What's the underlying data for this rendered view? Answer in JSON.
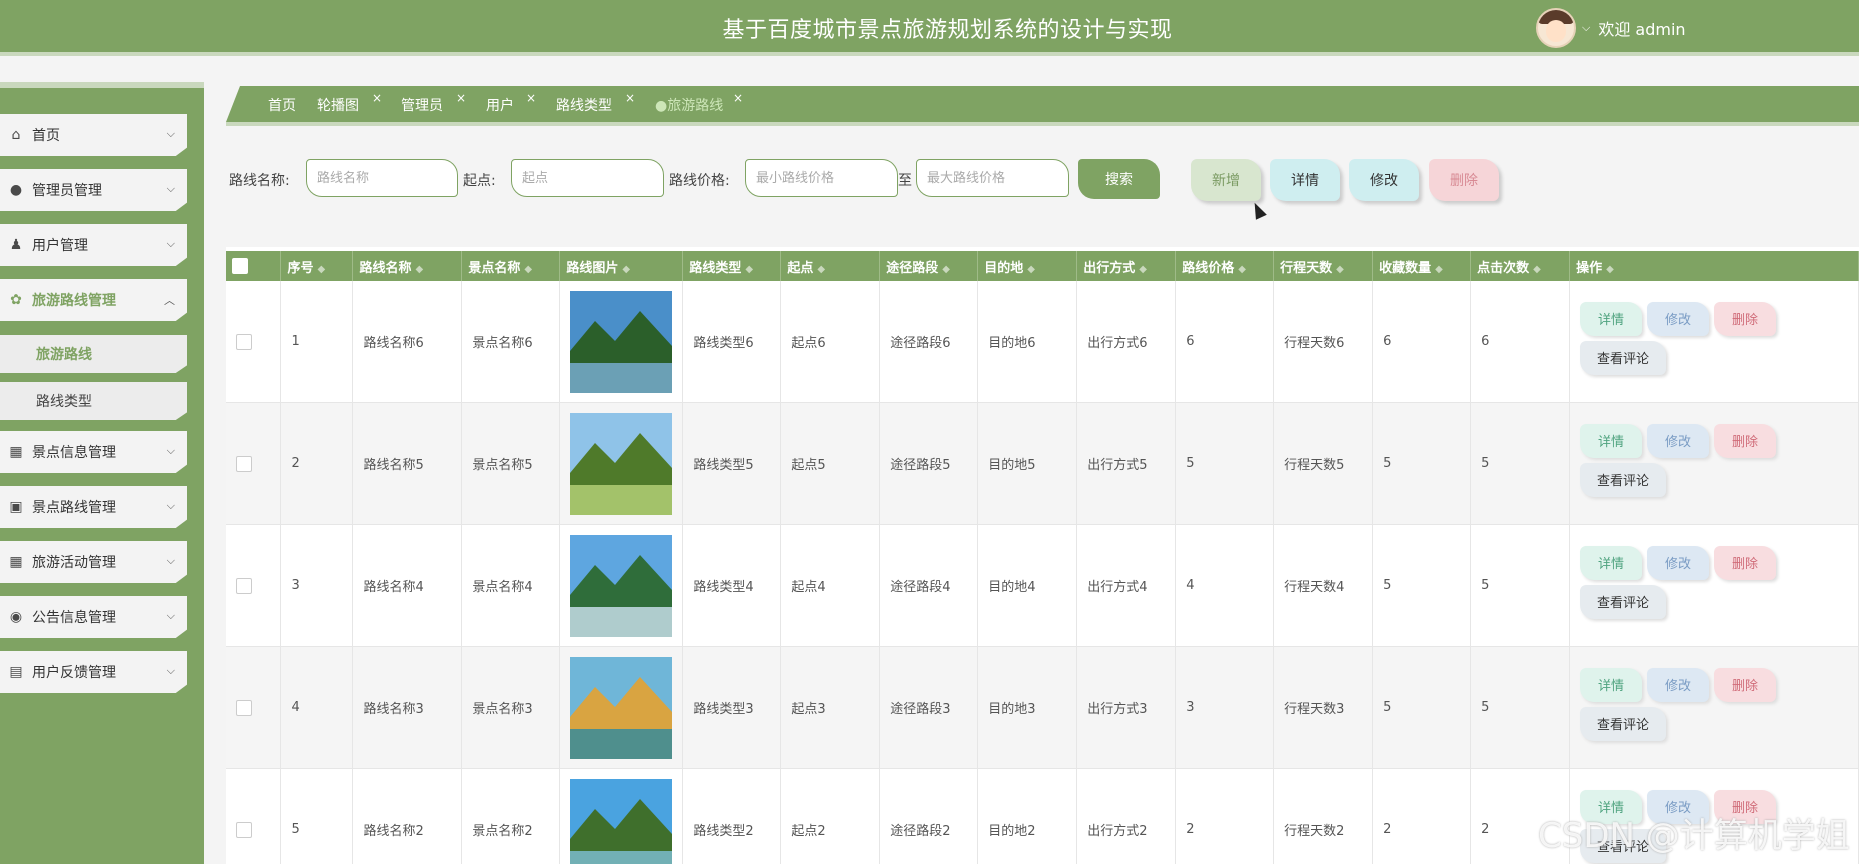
{
  "header": {
    "title": "基于百度城市景点旅游规划系统的设计与实现",
    "welcome": "欢迎 admin"
  },
  "sidebar": {
    "items": [
      {
        "label": "首页",
        "icon": "home-icon"
      },
      {
        "label": "管理员管理",
        "icon": "admin-icon"
      },
      {
        "label": "用户管理",
        "icon": "user-icon"
      },
      {
        "label": "旅游路线管理",
        "icon": "route-icon",
        "active": true,
        "children": [
          {
            "label": "旅游路线",
            "active": true
          },
          {
            "label": "路线类型"
          }
        ]
      },
      {
        "label": "景点信息管理",
        "icon": "grid-icon"
      },
      {
        "label": "景点路线管理",
        "icon": "image-icon"
      },
      {
        "label": "旅游活动管理",
        "icon": "grid-icon"
      },
      {
        "label": "公告信息管理",
        "icon": "notice-icon"
      },
      {
        "label": "用户反馈管理",
        "icon": "feedback-icon"
      }
    ]
  },
  "tabs": [
    {
      "label": "首页"
    },
    {
      "label": "轮播图"
    },
    {
      "label": "管理员"
    },
    {
      "label": "用户"
    },
    {
      "label": "路线类型"
    },
    {
      "label": "●旅游路线",
      "active": true
    }
  ],
  "search": {
    "route_name_label": "路线名称:",
    "route_name_placeholder": "路线名称",
    "start_label": "起点:",
    "start_placeholder": "起点",
    "price_label": "路线价格:",
    "min_price_placeholder": "最小路线价格",
    "to_label": "至",
    "max_price_placeholder": "最大路线价格",
    "search_button": "搜索"
  },
  "toolbar": {
    "add": "新增",
    "detail": "详情",
    "edit": "修改",
    "delete": "删除"
  },
  "table": {
    "headers": [
      "序号",
      "路线名称",
      "景点名称",
      "路线图片",
      "路线类型",
      "起点",
      "途径路段",
      "目的地",
      "出行方式",
      "路线价格",
      "行程天数",
      "收藏数量",
      "点击次数",
      "操作"
    ],
    "rows": [
      [
        "1",
        "路线名称6",
        "景点名称6",
        "",
        "路线类型6",
        "起点6",
        "途径路段6",
        "目的地6",
        "出行方式6",
        "6",
        "行程天数6",
        "6",
        "6"
      ],
      [
        "2",
        "路线名称5",
        "景点名称5",
        "",
        "路线类型5",
        "起点5",
        "途径路段5",
        "目的地5",
        "出行方式5",
        "5",
        "行程天数5",
        "5",
        "5"
      ],
      [
        "3",
        "路线名称4",
        "景点名称4",
        "",
        "路线类型4",
        "起点4",
        "途径路段4",
        "目的地4",
        "出行方式4",
        "4",
        "行程天数4",
        "5",
        "5"
      ],
      [
        "4",
        "路线名称3",
        "景点名称3",
        "",
        "路线类型3",
        "起点3",
        "途径路段3",
        "目的地3",
        "出行方式3",
        "3",
        "行程天数3",
        "5",
        "5"
      ],
      [
        "5",
        "路线名称2",
        "景点名称2",
        "",
        "路线类型2",
        "起点2",
        "途径路段2",
        "目的地2",
        "出行方式2",
        "2",
        "行程天数2",
        "2",
        "2"
      ]
    ],
    "ops": {
      "detail": "详情",
      "edit": "修改",
      "delete": "删除",
      "comments": "查看评论"
    }
  },
  "watermark": "CSDN @计算机学姐",
  "colors": {
    "primary": "#7fa363",
    "light": "#c9d8bd"
  }
}
